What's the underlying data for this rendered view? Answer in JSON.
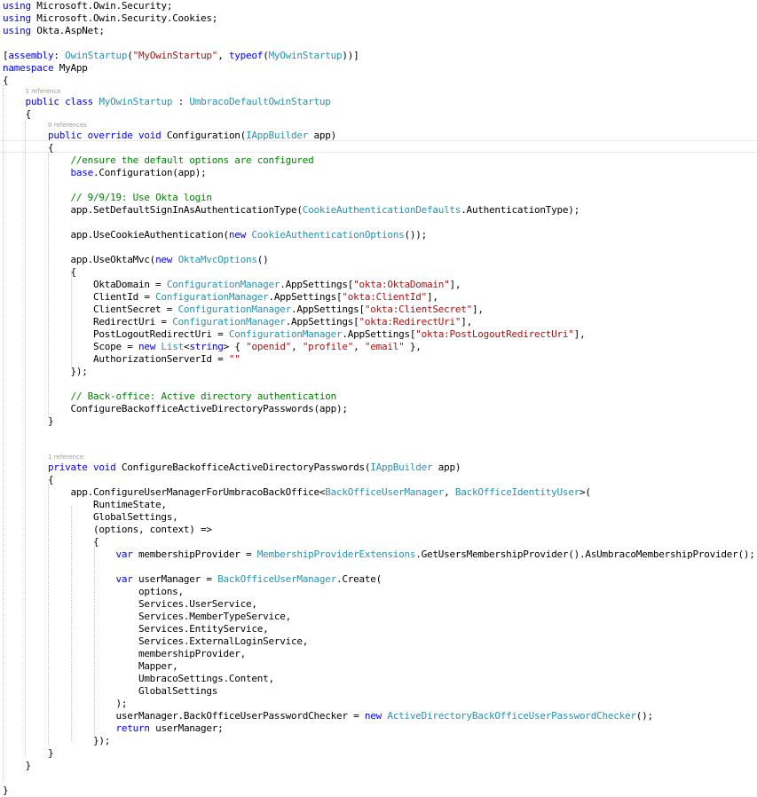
{
  "colors": {
    "background": "#ffffff",
    "keyword": "#0000ff",
    "type": "#2b91af",
    "string": "#a31515",
    "comment": "#008000",
    "plain": "#000000",
    "lens": "#9a9a9a"
  },
  "editor": {
    "lines": [
      {
        "type": "code",
        "segments": [
          {
            "k": "kw",
            "t": "using"
          },
          {
            "k": "pl",
            "t": " Microsoft.Owin.Security;"
          }
        ]
      },
      {
        "type": "code",
        "segments": [
          {
            "k": "kw",
            "t": "using"
          },
          {
            "k": "pl",
            "t": " Microsoft.Owin.Security.Cookies;"
          }
        ]
      },
      {
        "type": "code",
        "segments": [
          {
            "k": "kw",
            "t": "using"
          },
          {
            "k": "pl",
            "t": " Okta.AspNet;"
          }
        ]
      },
      {
        "type": "code",
        "segments": []
      },
      {
        "type": "code",
        "segments": [
          {
            "k": "pl",
            "t": "["
          },
          {
            "k": "kw",
            "t": "assembly"
          },
          {
            "k": "pl",
            "t": ": "
          },
          {
            "k": "ty",
            "t": "OwinStartup"
          },
          {
            "k": "pl",
            "t": "("
          },
          {
            "k": "str",
            "t": "\"MyOwinStartup\""
          },
          {
            "k": "pl",
            "t": ", "
          },
          {
            "k": "kw",
            "t": "typeof"
          },
          {
            "k": "pl",
            "t": "("
          },
          {
            "k": "ty",
            "t": "MyOwinStartup"
          },
          {
            "k": "pl",
            "t": "))]"
          }
        ]
      },
      {
        "type": "code",
        "segments": [
          {
            "k": "kw",
            "t": "namespace"
          },
          {
            "k": "pl",
            "t": " MyApp"
          }
        ]
      },
      {
        "type": "code",
        "segments": [
          {
            "k": "pl",
            "t": "{"
          }
        ]
      },
      {
        "type": "lens",
        "indent": "    ",
        "text": "1 reference"
      },
      {
        "type": "code",
        "segments": [
          {
            "k": "pl",
            "t": "    "
          },
          {
            "k": "kw",
            "t": "public"
          },
          {
            "k": "pl",
            "t": " "
          },
          {
            "k": "kw",
            "t": "class"
          },
          {
            "k": "pl",
            "t": " "
          },
          {
            "k": "ty",
            "t": "MyOwinStartup"
          },
          {
            "k": "pl",
            "t": " : "
          },
          {
            "k": "ty",
            "t": "UmbracoDefaultOwinStartup"
          }
        ]
      },
      {
        "type": "code",
        "segments": [
          {
            "k": "pl",
            "t": "    {"
          }
        ]
      },
      {
        "type": "lens",
        "indent": "        ",
        "text": "0 references"
      },
      {
        "type": "code",
        "segments": [
          {
            "k": "pl",
            "t": "        "
          },
          {
            "k": "kw",
            "t": "public"
          },
          {
            "k": "pl",
            "t": " "
          },
          {
            "k": "kw",
            "t": "override"
          },
          {
            "k": "pl",
            "t": " "
          },
          {
            "k": "kw",
            "t": "void"
          },
          {
            "k": "pl",
            "t": " Configuration("
          },
          {
            "k": "ty",
            "t": "IAppBuilder"
          },
          {
            "k": "pl",
            "t": " app)"
          }
        ]
      },
      {
        "type": "code",
        "segments": [
          {
            "k": "pl",
            "t": "        {"
          }
        ]
      },
      {
        "type": "code",
        "segments": [
          {
            "k": "pl",
            "t": "            "
          },
          {
            "k": "cm",
            "t": "//ensure the default options are configured"
          }
        ]
      },
      {
        "type": "code",
        "segments": [
          {
            "k": "pl",
            "t": "            "
          },
          {
            "k": "kw",
            "t": "base"
          },
          {
            "k": "pl",
            "t": ".Configuration(app);"
          }
        ]
      },
      {
        "type": "code",
        "segments": []
      },
      {
        "type": "code",
        "segments": [
          {
            "k": "pl",
            "t": "            "
          },
          {
            "k": "cm",
            "t": "// 9/9/19: Use Okta login"
          }
        ]
      },
      {
        "type": "code",
        "segments": [
          {
            "k": "pl",
            "t": "            app.SetDefaultSignInAsAuthenticationType("
          },
          {
            "k": "ty",
            "t": "CookieAuthenticationDefaults"
          },
          {
            "k": "pl",
            "t": ".AuthenticationType);"
          }
        ]
      },
      {
        "type": "code",
        "segments": []
      },
      {
        "type": "code",
        "segments": [
          {
            "k": "pl",
            "t": "            app.UseCookieAuthentication("
          },
          {
            "k": "kw",
            "t": "new"
          },
          {
            "k": "pl",
            "t": " "
          },
          {
            "k": "ty",
            "t": "CookieAuthenticationOptions"
          },
          {
            "k": "pl",
            "t": "());"
          }
        ]
      },
      {
        "type": "code",
        "segments": []
      },
      {
        "type": "code",
        "segments": [
          {
            "k": "pl",
            "t": "            app.UseOktaMvc("
          },
          {
            "k": "kw",
            "t": "new"
          },
          {
            "k": "pl",
            "t": " "
          },
          {
            "k": "ty",
            "t": "OktaMvcOptions"
          },
          {
            "k": "pl",
            "t": "()"
          }
        ]
      },
      {
        "type": "code",
        "segments": [
          {
            "k": "pl",
            "t": "            {"
          }
        ]
      },
      {
        "type": "code",
        "segments": [
          {
            "k": "pl",
            "t": "                OktaDomain = "
          },
          {
            "k": "ty",
            "t": "ConfigurationManager"
          },
          {
            "k": "pl",
            "t": ".AppSettings["
          },
          {
            "k": "str",
            "t": "\"okta:OktaDomain\""
          },
          {
            "k": "pl",
            "t": "],"
          }
        ]
      },
      {
        "type": "code",
        "segments": [
          {
            "k": "pl",
            "t": "                ClientId = "
          },
          {
            "k": "ty",
            "t": "ConfigurationManager"
          },
          {
            "k": "pl",
            "t": ".AppSettings["
          },
          {
            "k": "str",
            "t": "\"okta:ClientId\""
          },
          {
            "k": "pl",
            "t": "],"
          }
        ]
      },
      {
        "type": "code",
        "segments": [
          {
            "k": "pl",
            "t": "                ClientSecret = "
          },
          {
            "k": "ty",
            "t": "ConfigurationManager"
          },
          {
            "k": "pl",
            "t": ".AppSettings["
          },
          {
            "k": "str",
            "t": "\"okta:ClientSecret\""
          },
          {
            "k": "pl",
            "t": "],"
          }
        ]
      },
      {
        "type": "code",
        "segments": [
          {
            "k": "pl",
            "t": "                RedirectUri = "
          },
          {
            "k": "ty",
            "t": "ConfigurationManager"
          },
          {
            "k": "pl",
            "t": ".AppSettings["
          },
          {
            "k": "str",
            "t": "\"okta:RedirectUri\""
          },
          {
            "k": "pl",
            "t": "],"
          }
        ]
      },
      {
        "type": "code",
        "segments": [
          {
            "k": "pl",
            "t": "                PostLogoutRedirectUri = "
          },
          {
            "k": "ty",
            "t": "ConfigurationManager"
          },
          {
            "k": "pl",
            "t": ".AppSettings["
          },
          {
            "k": "str",
            "t": "\"okta:PostLogoutRedirectUri\""
          },
          {
            "k": "pl",
            "t": "],"
          }
        ]
      },
      {
        "type": "code",
        "segments": [
          {
            "k": "pl",
            "t": "                Scope = "
          },
          {
            "k": "kw",
            "t": "new"
          },
          {
            "k": "pl",
            "t": " "
          },
          {
            "k": "ty",
            "t": "List"
          },
          {
            "k": "pl",
            "t": "<"
          },
          {
            "k": "kw",
            "t": "string"
          },
          {
            "k": "pl",
            "t": "> { "
          },
          {
            "k": "str",
            "t": "\"openid\""
          },
          {
            "k": "pl",
            "t": ", "
          },
          {
            "k": "str",
            "t": "\"profile\""
          },
          {
            "k": "pl",
            "t": ", "
          },
          {
            "k": "str",
            "t": "\"email\""
          },
          {
            "k": "pl",
            "t": " },"
          }
        ]
      },
      {
        "type": "code",
        "segments": [
          {
            "k": "pl",
            "t": "                AuthorizationServerId = "
          },
          {
            "k": "str",
            "t": "\"\""
          }
        ]
      },
      {
        "type": "code",
        "segments": [
          {
            "k": "pl",
            "t": "            });"
          }
        ]
      },
      {
        "type": "code",
        "segments": []
      },
      {
        "type": "code",
        "segments": [
          {
            "k": "pl",
            "t": "            "
          },
          {
            "k": "cm",
            "t": "// Back-office: Active directory authentication"
          }
        ]
      },
      {
        "type": "code",
        "segments": [
          {
            "k": "pl",
            "t": "            ConfigureBackofficeActiveDirectoryPasswords(app);"
          }
        ]
      },
      {
        "type": "code",
        "segments": [
          {
            "k": "pl",
            "t": "        }"
          }
        ]
      },
      {
        "type": "code",
        "segments": []
      },
      {
        "type": "code",
        "segments": []
      },
      {
        "type": "lens",
        "indent": "        ",
        "text": "1 reference"
      },
      {
        "type": "code",
        "segments": [
          {
            "k": "pl",
            "t": "        "
          },
          {
            "k": "kw",
            "t": "private"
          },
          {
            "k": "pl",
            "t": " "
          },
          {
            "k": "kw",
            "t": "void"
          },
          {
            "k": "pl",
            "t": " ConfigureBackofficeActiveDirectoryPasswords("
          },
          {
            "k": "ty",
            "t": "IAppBuilder"
          },
          {
            "k": "pl",
            "t": " app)"
          }
        ]
      },
      {
        "type": "code",
        "segments": [
          {
            "k": "pl",
            "t": "        {"
          }
        ]
      },
      {
        "type": "code",
        "segments": [
          {
            "k": "pl",
            "t": "            app.ConfigureUserManagerForUmbracoBackOffice<"
          },
          {
            "k": "ty",
            "t": "BackOfficeUserManager"
          },
          {
            "k": "pl",
            "t": ", "
          },
          {
            "k": "ty",
            "t": "BackOfficeIdentityUser"
          },
          {
            "k": "pl",
            "t": ">("
          }
        ]
      },
      {
        "type": "code",
        "segments": [
          {
            "k": "pl",
            "t": "                RuntimeState,"
          }
        ]
      },
      {
        "type": "code",
        "segments": [
          {
            "k": "pl",
            "t": "                GlobalSettings,"
          }
        ]
      },
      {
        "type": "code",
        "segments": [
          {
            "k": "pl",
            "t": "                (options, context) =>"
          }
        ]
      },
      {
        "type": "code",
        "segments": [
          {
            "k": "pl",
            "t": "                {"
          }
        ]
      },
      {
        "type": "code",
        "segments": [
          {
            "k": "pl",
            "t": "                    "
          },
          {
            "k": "kw",
            "t": "var"
          },
          {
            "k": "pl",
            "t": " membershipProvider = "
          },
          {
            "k": "ty",
            "t": "MembershipProviderExtensions"
          },
          {
            "k": "pl",
            "t": ".GetUsersMembershipProvider().AsUmbracoMembershipProvider();"
          }
        ]
      },
      {
        "type": "code",
        "segments": []
      },
      {
        "type": "code",
        "segments": [
          {
            "k": "pl",
            "t": "                    "
          },
          {
            "k": "kw",
            "t": "var"
          },
          {
            "k": "pl",
            "t": " userManager = "
          },
          {
            "k": "ty",
            "t": "BackOfficeUserManager"
          },
          {
            "k": "pl",
            "t": ".Create("
          }
        ]
      },
      {
        "type": "code",
        "segments": [
          {
            "k": "pl",
            "t": "                        options,"
          }
        ]
      },
      {
        "type": "code",
        "segments": [
          {
            "k": "pl",
            "t": "                        Services.UserService,"
          }
        ]
      },
      {
        "type": "code",
        "segments": [
          {
            "k": "pl",
            "t": "                        Services.MemberTypeService,"
          }
        ]
      },
      {
        "type": "code",
        "segments": [
          {
            "k": "pl",
            "t": "                        Services.EntityService,"
          }
        ]
      },
      {
        "type": "code",
        "segments": [
          {
            "k": "pl",
            "t": "                        Services.ExternalLoginService,"
          }
        ]
      },
      {
        "type": "code",
        "segments": [
          {
            "k": "pl",
            "t": "                        membershipProvider,"
          }
        ]
      },
      {
        "type": "code",
        "segments": [
          {
            "k": "pl",
            "t": "                        Mapper,"
          }
        ]
      },
      {
        "type": "code",
        "segments": [
          {
            "k": "pl",
            "t": "                        UmbracoSettings.Content,"
          }
        ]
      },
      {
        "type": "code",
        "segments": [
          {
            "k": "pl",
            "t": "                        GlobalSettings"
          }
        ]
      },
      {
        "type": "code",
        "segments": [
          {
            "k": "pl",
            "t": "                    );"
          }
        ]
      },
      {
        "type": "code",
        "segments": [
          {
            "k": "pl",
            "t": "                    userManager.BackOfficeUserPasswordChecker = "
          },
          {
            "k": "kw",
            "t": "new"
          },
          {
            "k": "pl",
            "t": " "
          },
          {
            "k": "ty",
            "t": "ActiveDirectoryBackOfficeUserPasswordChecker"
          },
          {
            "k": "pl",
            "t": "();"
          }
        ]
      },
      {
        "type": "code",
        "segments": [
          {
            "k": "pl",
            "t": "                    "
          },
          {
            "k": "kw",
            "t": "return"
          },
          {
            "k": "pl",
            "t": " userManager;"
          }
        ]
      },
      {
        "type": "code",
        "segments": [
          {
            "k": "pl",
            "t": "                });"
          }
        ]
      },
      {
        "type": "code",
        "segments": [
          {
            "k": "pl",
            "t": "        }"
          }
        ]
      },
      {
        "type": "code",
        "segments": [
          {
            "k": "pl",
            "t": "    }"
          }
        ]
      },
      {
        "type": "code",
        "segments": []
      },
      {
        "type": "code",
        "segments": [
          {
            "k": "pl",
            "t": "}"
          }
        ]
      }
    ]
  }
}
